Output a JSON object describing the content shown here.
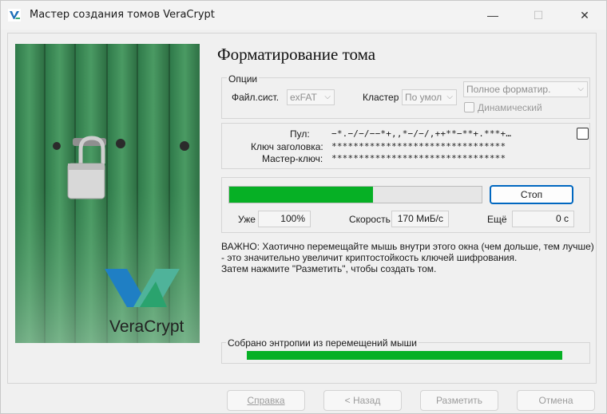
{
  "window": {
    "title": "Мастер создания томов VeraCrypt",
    "min_glyph": "—",
    "max_glyph": "☐",
    "close_glyph": "✕"
  },
  "page": {
    "heading": "Форматирование тома",
    "logo_text": "VeraCrypt"
  },
  "options": {
    "legend": "Опции",
    "fs_label": "Файл.сист.",
    "fs_value": "exFAT",
    "cluster_label": "Кластер",
    "cluster_value": "По умол",
    "format_value": "Полное форматир.",
    "dynamic_label": "Динамический",
    "dynamic_checked": false
  },
  "keys": {
    "pool_label": "Пул:",
    "pool_value": "−*.−/−/−−*+,,*−/−/,++**−**+.***+…",
    "header_key_label": "Ключ заголовка:",
    "header_key_value": "********************************",
    "master_key_label": "Мастер-ключ:",
    "master_key_value": "********************************",
    "show_checked": false
  },
  "progress": {
    "percent": 57,
    "stop_label": "Стоп",
    "done_label": "Уже",
    "done_value": "100%",
    "speed_label": "Скорость",
    "speed_value": "170 МиБ/с",
    "left_label": "Ещё",
    "left_value": "0 с"
  },
  "note": {
    "line1": "ВАЖНО: Хаотично перемещайте мышь внутри этого окна (чем дольше, тем лучше)",
    "line2": "- это значительно увеличит криптостойкость ключей шифрования.",
    "line3": "Затем нажмите \"Разметить\", чтобы создать том."
  },
  "entropy": {
    "legend": "Собрано энтропии из перемещений мыши",
    "fraction": 1.0
  },
  "buttons": {
    "help_label": "Справка",
    "back_label": "< Назад",
    "format_label": "Разметить",
    "cancel_label": "Отмена"
  },
  "colors": {
    "progress_green": "#06b025",
    "focus_blue": "#0067c0"
  }
}
